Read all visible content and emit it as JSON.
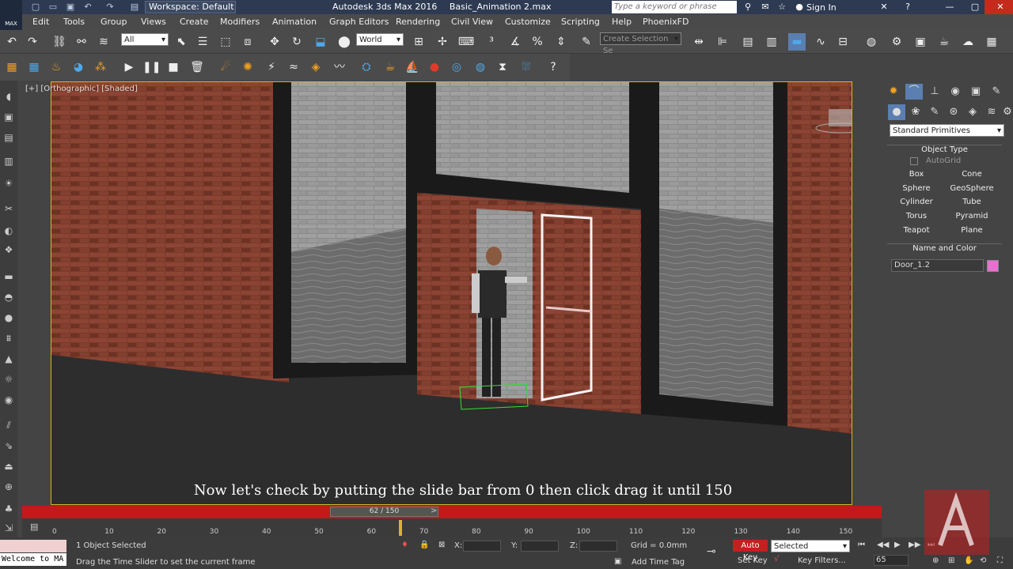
{
  "titlebar": {
    "workspace": "Workspace: Default",
    "app_title": "Autodesk 3ds Max 2016",
    "file_name": "Basic_Animation 2.max",
    "search_placeholder": "Type a keyword or phrase",
    "sign_in": "Sign In"
  },
  "menu": [
    "Edit",
    "Tools",
    "Group",
    "Views",
    "Create",
    "Modifiers",
    "Animation",
    "Graph Editors",
    "Rendering",
    "Civil View",
    "Customize",
    "Scripting",
    "Help",
    "PhoenixFD"
  ],
  "toolbar": {
    "selection_filter": "All",
    "ref_coord": "World",
    "named_selection": "Create Selection Se"
  },
  "viewport": {
    "label": "[+] [Orthographic] [Shaded]",
    "subtitle": "Now let's check by putting the slide bar from 0 then click drag it until 150"
  },
  "command_panel": {
    "category": "Standard Primitives",
    "object_type_header": "Object Type",
    "autogrid": "AutoGrid",
    "primitives": [
      "Box",
      "Cone",
      "Sphere",
      "GeoSphere",
      "Cylinder",
      "Tube",
      "Torus",
      "Pyramid",
      "Teapot",
      "Plane"
    ],
    "name_color_header": "Name and Color",
    "object_name": "Door_1.2",
    "object_color": "#e870d0"
  },
  "timeline": {
    "slider_label": "62 / 150",
    "ticks": [
      "0",
      "10",
      "20",
      "30",
      "40",
      "50",
      "60",
      "70",
      "80",
      "90",
      "100",
      "110",
      "120",
      "130",
      "140",
      "150"
    ]
  },
  "status": {
    "selection": "1 Object Selected",
    "prompt": "Drag the Time Slider to set the current frame",
    "x_label": "X:",
    "y_label": "Y:",
    "z_label": "Z:",
    "grid": "Grid = 0.0mm",
    "add_time_tag": "Add Time Tag",
    "auto_key": "Auto Key",
    "set_key": "Set Key",
    "key_mode": "Selected",
    "key_filters": "Key Filters...",
    "frame": "65",
    "listener": "Welcome to MA"
  }
}
